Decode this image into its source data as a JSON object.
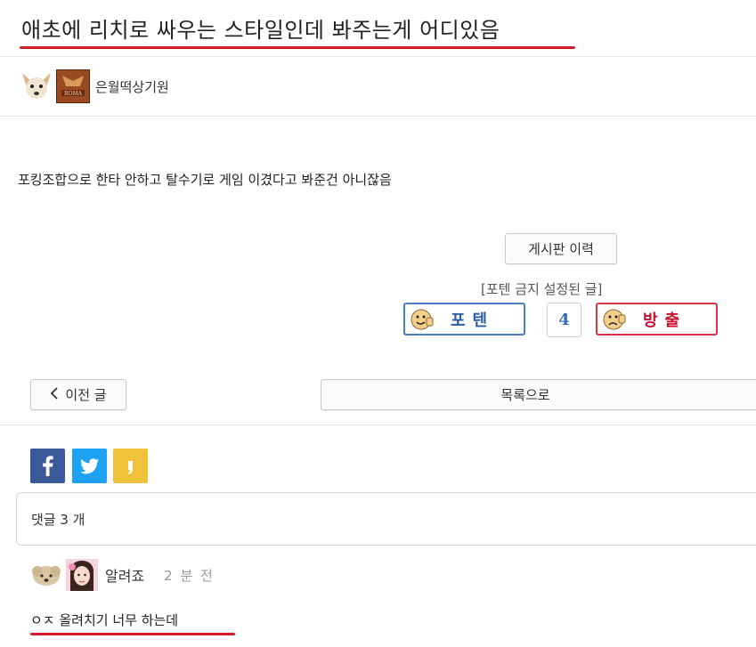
{
  "post": {
    "title": "애초에 리치로 싸우는 스타일인데 봐주는게 어디있음",
    "author": "은월떡상기원",
    "body": "포킹조합으로 한타 안하고 탈수기로 게임 이겼다고 봐준건 아니잖음",
    "roma_badge": "ROMA"
  },
  "actions": {
    "history_label": "게시판 이력",
    "banned_label": "[포텐 금지 설정된 글]",
    "vote_up_label": "포텐",
    "vote_down_label": "방출",
    "vote_count": "4",
    "prev_label": "이전 글",
    "list_label": "목록으로"
  },
  "share": {
    "facebook_icon": "facebook-icon",
    "twitter_icon": "twitter-icon",
    "kakaostory_icon": "kakaostory-icon"
  },
  "comments": {
    "count_label": "댓글 3 개",
    "items": [
      {
        "author": "알려죠",
        "time": "2 분 전",
        "text": "ㅇㅈ 올려치기 너무 하는데"
      }
    ]
  },
  "colors": {
    "accent_red": "#d61b27",
    "vote_blue": "#4a7fc6",
    "vote_red": "#d83448"
  }
}
